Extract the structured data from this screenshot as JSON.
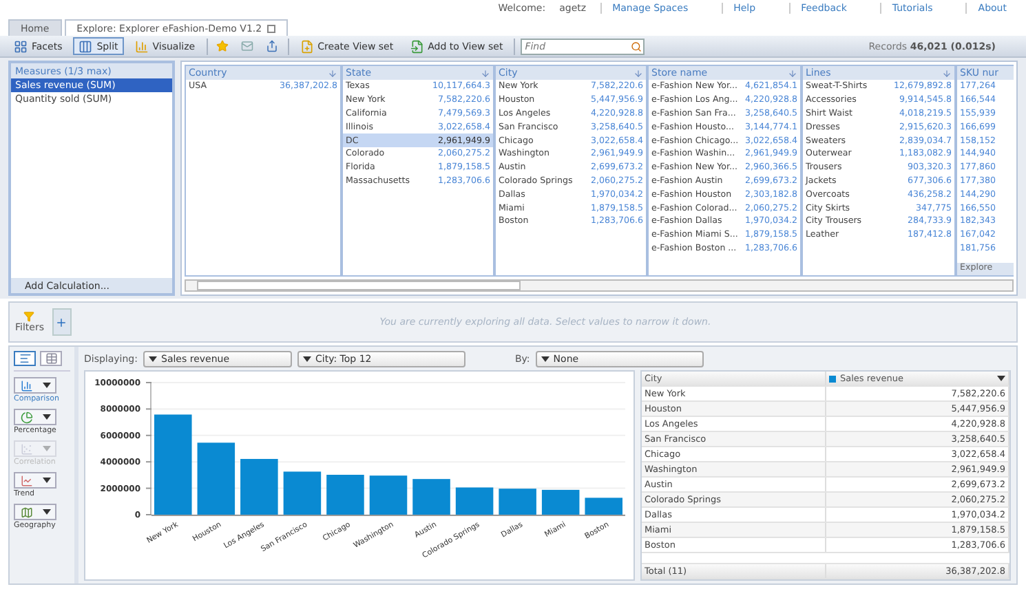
{
  "header": {
    "welcome_label": "Welcome:",
    "user": "agetz",
    "links": [
      "Manage Spaces",
      "Help",
      "Feedback",
      "Tutorials",
      "About"
    ]
  },
  "tabs": [
    {
      "label": "Home",
      "selected": false
    },
    {
      "label": "Explore: Explorer eFashion-Demo V1.2",
      "selected": true
    }
  ],
  "toolbar": {
    "modes": [
      {
        "label": "Facets",
        "kind": "facets",
        "selected": false
      },
      {
        "label": "Split",
        "kind": "split",
        "selected": true
      },
      {
        "label": "Visualize",
        "kind": "visualize",
        "selected": false
      }
    ],
    "actions": [
      {
        "label": "Create View set"
      },
      {
        "label": "Add to View set"
      }
    ],
    "search": {
      "placeholder": "Find"
    },
    "records_label": "Records",
    "records_count": "46,021",
    "records_time": "(0.012s)"
  },
  "measures": {
    "title": "Measures (1/3 max)",
    "items": [
      {
        "label": "Sales revenue (SUM)",
        "selected": true
      },
      {
        "label": "Quantity sold (SUM)",
        "selected": false
      }
    ],
    "add_button": "Add Calculation..."
  },
  "facets": [
    {
      "title": "Country",
      "items": [
        {
          "label": "USA",
          "value": "36,387,202.8",
          "selected": false
        }
      ]
    },
    {
      "title": "State",
      "items": [
        {
          "label": "Texas",
          "value": "10,117,664.3",
          "selected": false
        },
        {
          "label": "New York",
          "value": "7,582,220.6",
          "selected": false
        },
        {
          "label": "California",
          "value": "7,479,569.3",
          "selected": false
        },
        {
          "label": "Illinois",
          "value": "3,022,658.4",
          "selected": false
        },
        {
          "label": "DC",
          "value": "2,961,949.9",
          "selected": true
        },
        {
          "label": "Colorado",
          "value": "2,060,275.2",
          "selected": false
        },
        {
          "label": "Florida",
          "value": "1,879,158.5",
          "selected": false
        },
        {
          "label": "Massachusetts",
          "value": "1,283,706.6",
          "selected": false
        }
      ]
    },
    {
      "title": "City",
      "items": [
        {
          "label": "New York",
          "value": "7,582,220.6",
          "selected": false
        },
        {
          "label": "Houston",
          "value": "5,447,956.9",
          "selected": false
        },
        {
          "label": "Los Angeles",
          "value": "4,220,928.8",
          "selected": false
        },
        {
          "label": "San Francisco",
          "value": "3,258,640.5",
          "selected": false
        },
        {
          "label": "Chicago",
          "value": "3,022,658.4",
          "selected": false
        },
        {
          "label": "Washington",
          "value": "2,961,949.9",
          "selected": false
        },
        {
          "label": "Austin",
          "value": "2,699,673.2",
          "selected": false
        },
        {
          "label": "Colorado Springs",
          "value": "2,060,275.2",
          "selected": false
        },
        {
          "label": "Dallas",
          "value": "1,970,034.2",
          "selected": false
        },
        {
          "label": "Miami",
          "value": "1,879,158.5",
          "selected": false
        },
        {
          "label": "Boston",
          "value": "1,283,706.6",
          "selected": false
        }
      ]
    },
    {
      "title": "Store name",
      "items": [
        {
          "label": "e-Fashion New Yor...",
          "value": "4,621,854.1",
          "selected": false
        },
        {
          "label": "e-Fashion Los Ang...",
          "value": "4,220,928.8",
          "selected": false
        },
        {
          "label": "e-Fashion San Fra...",
          "value": "3,258,640.5",
          "selected": false
        },
        {
          "label": "e-Fashion Housto...",
          "value": "3,144,774.1",
          "selected": false
        },
        {
          "label": "e-Fashion Chicago...",
          "value": "3,022,658.4",
          "selected": false
        },
        {
          "label": "e-Fashion Washin...",
          "value": "2,961,949.9",
          "selected": false
        },
        {
          "label": "e-Fashion New Yor...",
          "value": "2,960,366.5",
          "selected": false
        },
        {
          "label": "e-Fashion Austin",
          "value": "2,699,673.2",
          "selected": false
        },
        {
          "label": "e-Fashion Houston",
          "value": "2,303,182.8",
          "selected": false
        },
        {
          "label": "e-Fashion Colorad...",
          "value": "2,060,275.2",
          "selected": false
        },
        {
          "label": "e-Fashion Dallas",
          "value": "1,970,034.2",
          "selected": false
        },
        {
          "label": "e-Fashion Miami S...",
          "value": "1,879,158.5",
          "selected": false
        },
        {
          "label": "e-Fashion Boston ...",
          "value": "1,283,706.6",
          "selected": false
        }
      ]
    },
    {
      "title": "Lines",
      "items": [
        {
          "label": "Sweat-T-Shirts",
          "value": "12,679,892.8",
          "selected": false
        },
        {
          "label": "Accessories",
          "value": "9,914,545.8",
          "selected": false
        },
        {
          "label": "Shirt Waist",
          "value": "4,018,219.5",
          "selected": false
        },
        {
          "label": "Dresses",
          "value": "2,915,620.3",
          "selected": false
        },
        {
          "label": "Sweaters",
          "value": "2,839,034.7",
          "selected": false
        },
        {
          "label": "Outerwear",
          "value": "1,183,082.9",
          "selected": false
        },
        {
          "label": "Trousers",
          "value": "903,320.3",
          "selected": false
        },
        {
          "label": "Jackets",
          "value": "677,306.6",
          "selected": false
        },
        {
          "label": "Overcoats",
          "value": "436,258.2",
          "selected": false
        },
        {
          "label": "City Skirts",
          "value": "347,775",
          "selected": false
        },
        {
          "label": "City Trousers",
          "value": "284,733.9",
          "selected": false
        },
        {
          "label": "Leather",
          "value": "187,412.8",
          "selected": false
        }
      ]
    },
    {
      "title": "SKU nur",
      "footer": "Explore",
      "items": [
        {
          "value": "177,264",
          "selected": false
        },
        {
          "value": "166,544",
          "selected": false
        },
        {
          "value": "155,939",
          "selected": false
        },
        {
          "value": "166,699",
          "selected": false
        },
        {
          "value": "158,152",
          "selected": false
        },
        {
          "value": "144,940",
          "selected": false
        },
        {
          "value": "177,860",
          "selected": false
        },
        {
          "value": "177,380",
          "selected": false
        },
        {
          "value": "144,290",
          "selected": false
        },
        {
          "value": "166,550",
          "selected": false
        },
        {
          "value": "182,343",
          "selected": false
        },
        {
          "value": "167,042",
          "selected": false
        },
        {
          "value": "181,756",
          "selected": false
        }
      ]
    }
  ],
  "filters": {
    "label": "Filters",
    "message": "You are currently exploring all data. Select values to narrow it down."
  },
  "views": [
    {
      "kind": "chart",
      "selected": true
    },
    {
      "kind": "table",
      "selected": false
    }
  ],
  "chart_types": [
    {
      "label": "Comparison",
      "kind": "comparison",
      "selected": true,
      "disabled": false
    },
    {
      "label": "Percentage",
      "kind": "percentage",
      "selected": false,
      "disabled": false
    },
    {
      "label": "Correlation",
      "kind": "correlation",
      "selected": false,
      "disabled": true
    },
    {
      "label": "Trend",
      "kind": "trend",
      "selected": false,
      "disabled": false
    },
    {
      "label": "Geography",
      "kind": "geography",
      "selected": false,
      "disabled": false
    }
  ],
  "displaying": {
    "label": "Displaying:",
    "measure": "Sales revenue",
    "dimension": "City: Top 12",
    "by_label": "By:",
    "by_value": "None"
  },
  "chart_data": {
    "type": "bar",
    "categories": [
      "New York",
      "Houston",
      "Los Angeles",
      "San Francisco",
      "Chicago",
      "Washington",
      "Austin",
      "Colorado Springs",
      "Dallas",
      "Miami",
      "Boston"
    ],
    "series": [
      {
        "name": "Sales revenue",
        "color": "#0a8ad2",
        "values": [
          7580000,
          5450000,
          4220000,
          3260000,
          3020000,
          2960000,
          2700000,
          2060000,
          1970000,
          1880000,
          1280000
        ]
      }
    ],
    "ylim": [
      0,
      10000000
    ],
    "grid": true,
    "yticks": [
      0,
      2000000,
      4000000,
      6000000,
      8000000,
      10000000
    ]
  },
  "table": {
    "columns": [
      "City"
    ],
    "rows": [
      {
        "city": "New York",
        "value": "7,582,220.6"
      },
      {
        "city": "Houston",
        "value": "5,447,956.9"
      },
      {
        "city": "Los Angeles",
        "value": "4,220,928.8"
      },
      {
        "city": "San Francisco",
        "value": "3,258,640.5"
      },
      {
        "city": "Chicago",
        "value": "3,022,658.4"
      },
      {
        "city": "Washington",
        "value": "2,961,949.9"
      },
      {
        "city": "Austin",
        "value": "2,699,673.2"
      },
      {
        "city": "Colorado Springs",
        "value": "2,060,275.2"
      },
      {
        "city": "Dallas",
        "value": "1,970,034.2"
      },
      {
        "city": "Miami",
        "value": "1,879,158.5"
      },
      {
        "city": "Boston",
        "value": "1,283,706.6"
      }
    ],
    "total_label": "Total (11)",
    "total_value": "36,387,202.8"
  }
}
